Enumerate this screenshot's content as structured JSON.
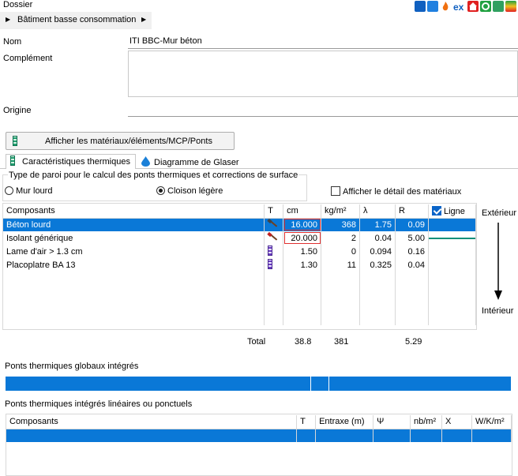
{
  "header": {
    "section": "Dossier",
    "breadcrumb": "Bâtiment basse consommation"
  },
  "form": {
    "nom_label": "Nom",
    "nom_value": "ITI BBC-Mur béton",
    "complement_label": "Complément",
    "complement_value": "",
    "origine_label": "Origine",
    "origine_value": ""
  },
  "actions": {
    "afficher_materiaux": "Afficher les matériaux/éléments/MCP/Ponts"
  },
  "tabs": [
    {
      "label": "Caractéristiques thermiques"
    },
    {
      "label": "Diagramme de Glaser"
    }
  ],
  "paroi": {
    "group_label": "Type de paroi pour le calcul des ponts thermiques et corrections de surface",
    "option_mur_lourd": "Mur lourd",
    "option_cloison_legere": "Cloison légère",
    "selected": "Cloison légère",
    "detail_checkbox": "Afficher le détail des matériaux"
  },
  "materials": {
    "columns": [
      "Composants",
      "T",
      "cm",
      "kg/m²",
      "λ",
      "R",
      "Ligne"
    ],
    "rows": [
      {
        "name": "Béton lourd",
        "cm": "16.000",
        "kg": "368",
        "lambda": "1.75",
        "r": "0.09"
      },
      {
        "name": "Isolant générique",
        "cm": "20.000",
        "kg": "2",
        "lambda": "0.04",
        "r": "5.00"
      },
      {
        "name": "Lame d'air > 1.3 cm",
        "cm": "1.50",
        "kg": "0",
        "lambda": "0.094",
        "r": "0.16"
      },
      {
        "name": "Placoplatre BA 13",
        "cm": "1.30",
        "kg": "11",
        "lambda": "0.325",
        "r": "0.04"
      }
    ],
    "total_label": "Total",
    "total_cm": "38.8",
    "total_kg": "381",
    "total_r": "5.29",
    "exterieur": "Extérieur",
    "interieur": "Intérieur"
  },
  "ponts_globaux": {
    "title": "Ponts thermiques globaux intégrés"
  },
  "ponts_lineaires": {
    "title": "Ponts thermiques intégrés linéaires ou ponctuels",
    "columns": [
      "Composants",
      "T",
      "Entraxe (m)",
      "Ψ",
      "nb/m²",
      "X",
      "W/K/m²"
    ]
  },
  "toolbar_icons": {
    "ex_label": "ex"
  }
}
